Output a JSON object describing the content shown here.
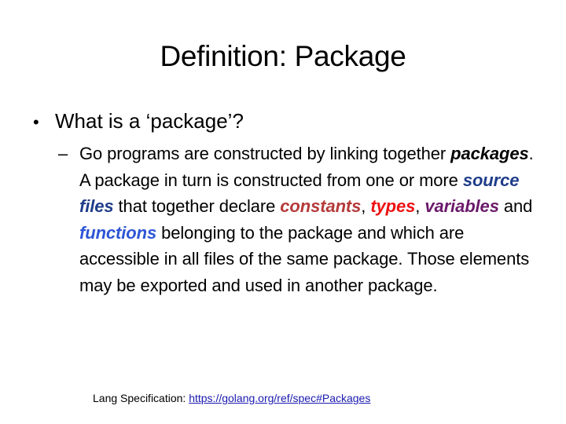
{
  "slide": {
    "title": "Definition: Package",
    "bullet": {
      "marker": "•",
      "text": "What is  a ‘package’?"
    },
    "sub": {
      "marker": "–",
      "segments": [
        {
          "text": "Go programs are constructed by linking together ",
          "style": "plain"
        },
        {
          "text": "packages",
          "style": "kw",
          "color": "#000000"
        },
        {
          "text": ". A package in turn is constructed from one or more ",
          "style": "plain"
        },
        {
          "text": "source files",
          "style": "kw",
          "color": "#1f3d8a"
        },
        {
          "text": " that together declare ",
          "style": "plain"
        },
        {
          "text": "constants",
          "style": "kw",
          "color": "#b53a3a"
        },
        {
          "text": ", ",
          "style": "plain"
        },
        {
          "text": "types",
          "style": "kw",
          "color": "#ee1111"
        },
        {
          "text": ", ",
          "style": "plain"
        },
        {
          "text": "variables",
          "style": "kw",
          "color": "#6b1a6b"
        },
        {
          "text": " and ",
          "style": "plain"
        },
        {
          "text": "functions",
          "style": "kw",
          "color": "#2e55d6"
        },
        {
          "text": " belonging to the package and which are accessible in all files of the same package. Those elements may be exported and used in another package.",
          "style": "plain"
        }
      ]
    },
    "footer": {
      "label": "Lang Specification: ",
      "link_text": "https://golang.org/ref/spec#Packages"
    }
  }
}
